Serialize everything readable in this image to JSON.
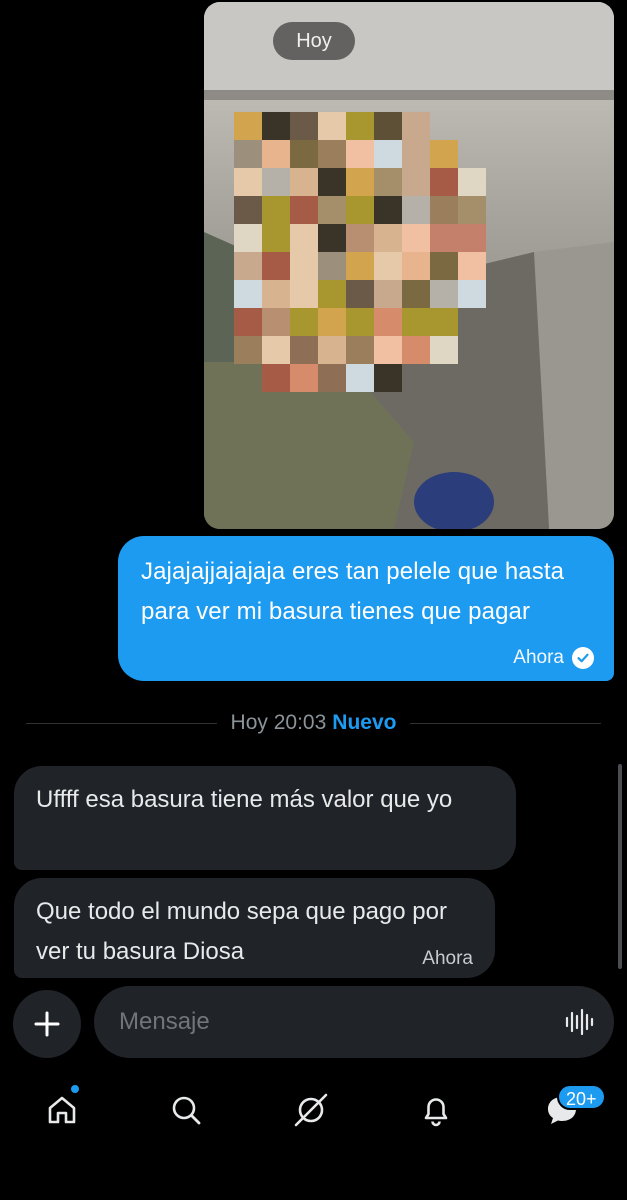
{
  "thread": {
    "photo_date_label": "Hoy",
    "sent_message": {
      "text": "Jajajajjajajaja eres tan pelele que hasta para ver mi basura tienes que pagar",
      "time": "Ahora"
    },
    "divider": {
      "time": "Hoy 20:03",
      "new_label": "Nuevo"
    },
    "received_messages": [
      {
        "text": "Uffff esa basura tiene más valor que yo"
      },
      {
        "text": "Que todo el mundo sepa que pago por ver tu basura Diosa",
        "time": "Ahora"
      }
    ]
  },
  "composer": {
    "placeholder": "Mensaje"
  },
  "nav": {
    "items": [
      "home-icon",
      "search-icon",
      "grok-icon",
      "notifications-icon",
      "messages-icon"
    ],
    "messages_badge": "20+"
  },
  "colors": {
    "accent": "#1d9bf0",
    "bubble_received": "#202327",
    "background": "#000000"
  }
}
